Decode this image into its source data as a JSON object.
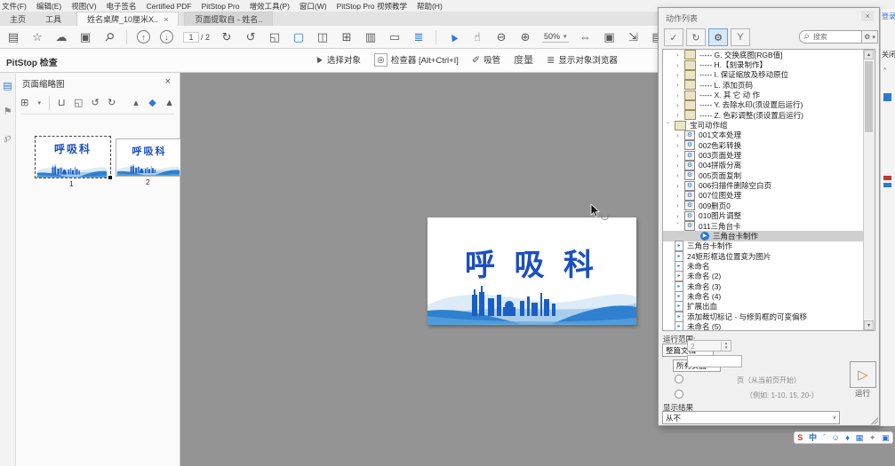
{
  "menu": {
    "items": [
      "文件(F)",
      "编辑(E)",
      "视图(V)",
      "电子签名",
      "Certified PDF",
      "PitStop Pro",
      "增效工具(P)",
      "窗口(W)",
      "PitStop Pro 视频教学",
      "帮助(H)"
    ]
  },
  "tabs": {
    "home": "主页",
    "tools": "工具",
    "docs": [
      {
        "label": "姓名桌牌_10厘米X..",
        "close": "×",
        "active": true
      },
      {
        "label": "页面提取自 - 姓名..",
        "close": "",
        "active": false
      }
    ]
  },
  "toolbar": {
    "page_current": "1",
    "page_total": "/ 2",
    "zoom_value": "50%",
    "items": [
      {
        "name": "save-icon",
        "glyph": "▤"
      },
      {
        "name": "star-icon",
        "glyph": "☆"
      },
      {
        "name": "cloud-upload-icon",
        "glyph": "☁"
      },
      {
        "name": "print-icon",
        "glyph": "▣"
      },
      {
        "name": "search-icon",
        "glyph": "⚲",
        "cls": "mag"
      },
      {
        "type": "sep"
      },
      {
        "name": "previous-page-icon",
        "glyph": "↑",
        "circle": true
      },
      {
        "name": "next-page-icon",
        "glyph": "↓",
        "circle": true
      },
      {
        "type": "pagebox"
      },
      {
        "name": "rotate-right-icon",
        "glyph": "↻"
      },
      {
        "name": "rotate-left-icon",
        "glyph": "↺"
      },
      {
        "name": "crop-pages-icon",
        "glyph": "◱"
      },
      {
        "name": "insert-page-icon",
        "glyph": "▢",
        "color": "#2b7bd4"
      },
      {
        "name": "split-page-icon",
        "glyph": "◫"
      },
      {
        "name": "page-tiles-icon",
        "glyph": "⊞"
      },
      {
        "name": "facing-pages-icon",
        "glyph": "▥"
      },
      {
        "name": "fullscreen-icon",
        "glyph": "▭"
      },
      {
        "name": "reading-mode-icon",
        "glyph": "≣",
        "color": "#2b7bd4"
      },
      {
        "type": "sep"
      },
      {
        "name": "select-tool-icon",
        "glyph": "▲",
        "color": "#2b7bd4",
        "cls": "sel-arrow"
      },
      {
        "name": "hand-tool-icon",
        "glyph": "☝"
      },
      {
        "name": "zoom-out-icon",
        "glyph": "⊖"
      },
      {
        "name": "zoom-in-icon",
        "glyph": "⊕"
      },
      {
        "type": "zoom"
      },
      {
        "name": "fit-width-icon",
        "glyph": "⇔"
      },
      {
        "name": "actual-size-icon",
        "glyph": "▣"
      },
      {
        "name": "fit-page-icon",
        "glyph": "⇲"
      },
      {
        "name": "fit-visible-icon",
        "glyph": "▤",
        "caret": true
      },
      {
        "name": "scroll-pages-icon",
        "glyph": "⇩"
      },
      {
        "type": "sep"
      },
      {
        "name": "comment-icon",
        "glyph": "✎"
      }
    ]
  },
  "pitstop_bar": {
    "title": "PitStop 检查",
    "select_object": "选择对象",
    "inspector": "检查器 [Alt+Ctrl+I]",
    "eyedropper": "吸管",
    "measure": "度量",
    "object_browser": "显示对象浏览器",
    "icons": {
      "select": "▲",
      "inspector": "◎",
      "eyedropper": "✐",
      "measure": "╱",
      "browser": "≣"
    }
  },
  "sidebar": {
    "items": [
      {
        "name": "page-thumbnails-icon",
        "glyph": "▤",
        "color": "#2b7bd4"
      },
      {
        "name": "bookmarks-icon",
        "glyph": "⚑",
        "color": "#8a8a8a"
      },
      {
        "name": "attachments-icon",
        "glyph": "℘",
        "color": "#8a8a8a"
      }
    ]
  },
  "thumbnails_panel": {
    "title": "页面缩略图",
    "close": "×",
    "toolbar": [
      {
        "name": "thumbnail-options-icon",
        "glyph": "⊞",
        "caret": true
      },
      {
        "type": "sep"
      },
      {
        "name": "delete-page-icon",
        "glyph": "⊔"
      },
      {
        "name": "crop-page-icon",
        "glyph": "◱"
      },
      {
        "name": "rotate-left-icon",
        "glyph": "↺"
      },
      {
        "name": "rotate-right-icon",
        "glyph": "↻"
      },
      {
        "type": "spacer"
      },
      {
        "name": "smaller-thumbnails-icon",
        "glyph": "▴"
      },
      {
        "name": "thumbnail-size-marker-icon",
        "glyph": "◆",
        "color": "#2b7bd4"
      },
      {
        "name": "larger-thumbnails-icon",
        "glyph": "▲"
      }
    ],
    "pages": [
      {
        "num": "1",
        "text": "呼吸科"
      },
      {
        "num": "2",
        "text": "呼吸科"
      }
    ]
  },
  "document": {
    "banner_text": "呼 吸 科"
  },
  "actions_panel": {
    "title": "动作列表",
    "close": "×",
    "search_placeholder": "搜索",
    "toolbar_icons": {
      "check": "✓",
      "sync": "↻",
      "gear": "⚙",
      "funnel": "Y",
      "search": "⚲",
      "gear_menu": "⚙",
      "caret": "▾"
    },
    "tree": [
      {
        "level": 1,
        "expander": "›",
        "icon": "folder",
        "label": "----- G. 交换底图[RGB值]"
      },
      {
        "level": 1,
        "expander": "›",
        "icon": "folder",
        "label": "----- H.【刻录制作】"
      },
      {
        "level": 1,
        "expander": "›",
        "icon": "folder",
        "label": "----- I. 保证缩放及移动原位"
      },
      {
        "level": 1,
        "expander": "›",
        "icon": "folder",
        "label": "----- L. 添加页码"
      },
      {
        "level": 1,
        "expander": "›",
        "icon": "folder",
        "label": "----- X. 其 它 动 作"
      },
      {
        "level": 1,
        "expander": "›",
        "icon": "folder",
        "label": "----- Y. 去除水印(须设置后运行)"
      },
      {
        "level": 1,
        "expander": "›",
        "icon": "folder",
        "label": "----- Z. 色彩调整(须设置后运行)"
      },
      {
        "level": 0,
        "expander": "ˇ",
        "icon": "folder",
        "label": "宝司动作组"
      },
      {
        "level": 1,
        "expander": "›",
        "icon": "action",
        "label": "001文本处理"
      },
      {
        "level": 1,
        "expander": "›",
        "icon": "action",
        "label": "002色彩转换"
      },
      {
        "level": 1,
        "expander": "›",
        "icon": "action",
        "label": "003页面处理"
      },
      {
        "level": 1,
        "expander": "›",
        "icon": "action",
        "label": "004拼版分离"
      },
      {
        "level": 1,
        "expander": "›",
        "icon": "action",
        "label": "005页面复制"
      },
      {
        "level": 1,
        "expander": "›",
        "icon": "action",
        "label": "006扫描件删除空白页"
      },
      {
        "level": 1,
        "expander": "›",
        "icon": "action",
        "label": "007位图处理"
      },
      {
        "level": 1,
        "expander": "›",
        "icon": "action",
        "label": "009删页0"
      },
      {
        "level": 1,
        "expander": "›",
        "icon": "action",
        "label": "010图片调整"
      },
      {
        "level": 1,
        "expander": "ˇ",
        "icon": "action",
        "label": "011三角台卡"
      },
      {
        "level": 2,
        "expander": "",
        "icon": "play",
        "label": "三角台卡制作",
        "selected": true
      },
      {
        "level": 0,
        "expander": "",
        "icon": "file",
        "label": "三角台卡制作"
      },
      {
        "level": 0,
        "expander": "",
        "icon": "file",
        "label": "24矩形框选位置变为图片"
      },
      {
        "level": 0,
        "expander": "",
        "icon": "file",
        "label": "未命名"
      },
      {
        "level": 0,
        "expander": "",
        "icon": "file",
        "label": "未命名 (2)"
      },
      {
        "level": 0,
        "expander": "",
        "icon": "file",
        "label": "未命名 (3)"
      },
      {
        "level": 0,
        "expander": "",
        "icon": "file",
        "label": "未命名 (4)"
      },
      {
        "level": 0,
        "expander": "",
        "icon": "file",
        "label": "扩展出血"
      },
      {
        "level": 0,
        "expander": "",
        "icon": "file",
        "label": "添加裁切标记 - 与修剪框的可变偏移"
      },
      {
        "level": 0,
        "expander": "",
        "icon": "file",
        "label": "未命名 (5)"
      }
    ],
    "tree_icon_glyphs": {
      "folder": "",
      "action": "⚙",
      "file": "▸",
      "play": "▶"
    },
    "scrollbar": {
      "up": "▴",
      "down": "▾"
    },
    "run_scope_label": "运行范围:",
    "scope_document": "整篇文档",
    "scope_pages": "所有页面",
    "pages_value": "2",
    "pages_suffix": "页（从当前页开始）",
    "range_example": "（例如: 1-10, 15, 20-）",
    "show_results_label": "显示结果",
    "show_results_value": "从不",
    "run_icon": "▷",
    "run_label": "运行",
    "dropdown_caret": "∨"
  },
  "right_strip": {
    "login": "登录",
    "close": "关闭",
    "scroll_up": "˄"
  },
  "ime_bar": {
    "icons": [
      {
        "name": "sogou-logo-icon",
        "glyph": "S",
        "color": "#d93a2b"
      },
      {
        "name": "chinese-mode-icon",
        "glyph": "中",
        "color": "#2a6fce"
      },
      {
        "name": "punctuation-icon",
        "glyph": "ˊ",
        "color": "#2a6fce"
      },
      {
        "name": "emoji-icon",
        "glyph": "☺",
        "color": "#2a6fce"
      },
      {
        "name": "voice-input-icon",
        "glyph": "♦",
        "color": "#2a6fce"
      },
      {
        "name": "soft-keyboard-icon",
        "glyph": "▦",
        "color": "#2a6fce"
      },
      {
        "name": "toolbox-icon",
        "glyph": "✦",
        "color": "#8a8a8a"
      },
      {
        "name": "skin-icon",
        "glyph": "▣",
        "color": "#2a6fce"
      }
    ]
  },
  "colors": {
    "accent_blue": "#2b7bd4",
    "banner_text_blue": "#1b4fc0",
    "doc_background": "#949494",
    "selected_row": "#cfcfcf"
  }
}
